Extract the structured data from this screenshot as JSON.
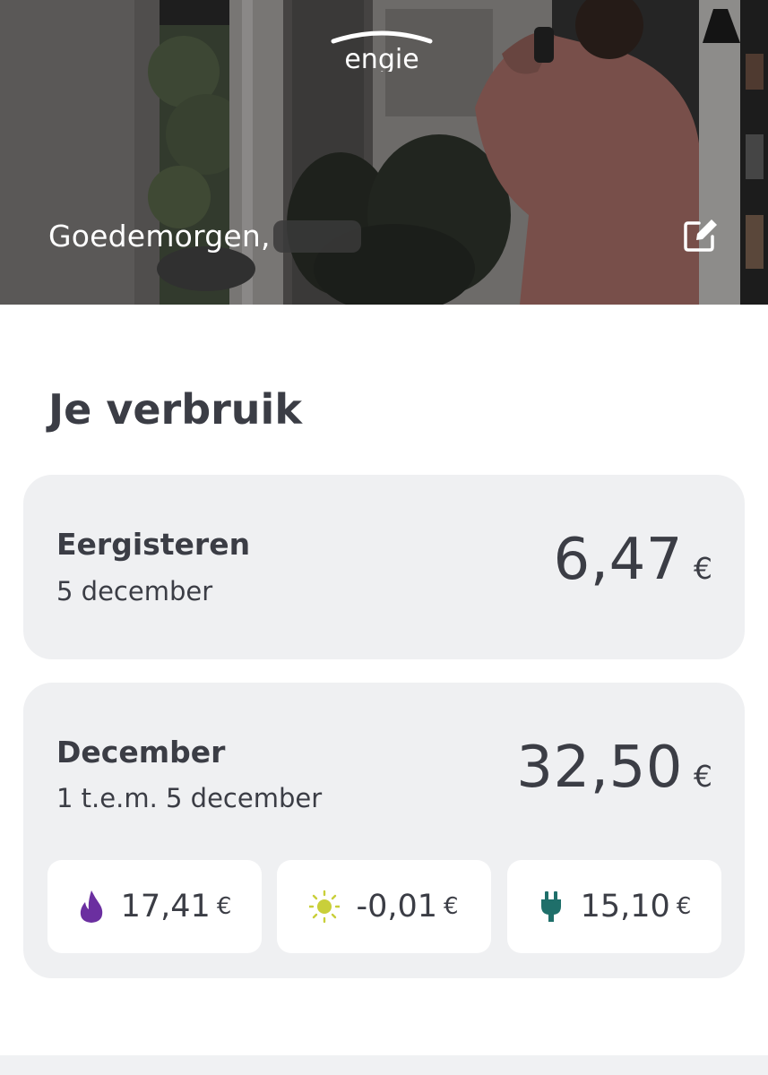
{
  "header": {
    "brand": "engie",
    "greeting": "Goedemorgen,"
  },
  "usage": {
    "section_title": "Je verbruik",
    "day_card": {
      "title": "Eergisteren",
      "date": "5 december",
      "amount": "6,47",
      "currency": "€"
    },
    "month_card": {
      "title": "December",
      "period": "1 t.e.m. 5 december",
      "amount": "32,50",
      "currency": "€",
      "breakdown": [
        {
          "icon": "flame-icon",
          "value": "17,41",
          "currency": "€",
          "color": "#6b2fa0"
        },
        {
          "icon": "sun-icon",
          "value": "-0,01",
          "currency": "€",
          "color": "#c9cf3a"
        },
        {
          "icon": "plug-icon",
          "value": "15,10",
          "currency": "€",
          "color": "#1f6f6a"
        }
      ]
    }
  },
  "colors": {
    "card_bg": "#eff0f2",
    "text": "#3b3d45",
    "gas": "#6b2fa0",
    "solar": "#c9cf3a",
    "electricity": "#1f6f6a"
  }
}
